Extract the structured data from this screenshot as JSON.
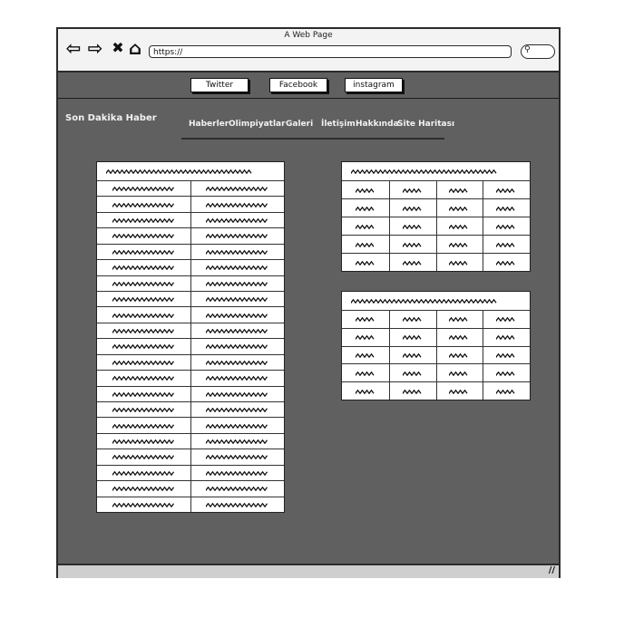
{
  "browser": {
    "title": "A Web Page",
    "url": "https://",
    "back_glyph": "⇦",
    "forward_glyph": "⇨",
    "close_glyph": "✖",
    "home_glyph": "⌂",
    "search_glyph": "⚲",
    "grip_glyph": "//"
  },
  "social": {
    "twitter": "Twitter",
    "facebook": "Facebook",
    "instagram": "instagram"
  },
  "site": {
    "brand": "Son Dakika Haber",
    "menu": [
      "Haberler",
      "Olimpiyatlar",
      "Galeri",
      "İletişim",
      "Hakkında",
      "Site Haritası"
    ]
  },
  "tables": {
    "left": {
      "rows": 21,
      "cols": 2
    },
    "right_top": {
      "rows": 5,
      "cols": 4
    },
    "right_bottom": {
      "rows": 5,
      "cols": 4
    }
  },
  "colors": {
    "page_bg": "#606060",
    "chrome_bg": "#f3f3f3",
    "scribble": "#111111"
  }
}
